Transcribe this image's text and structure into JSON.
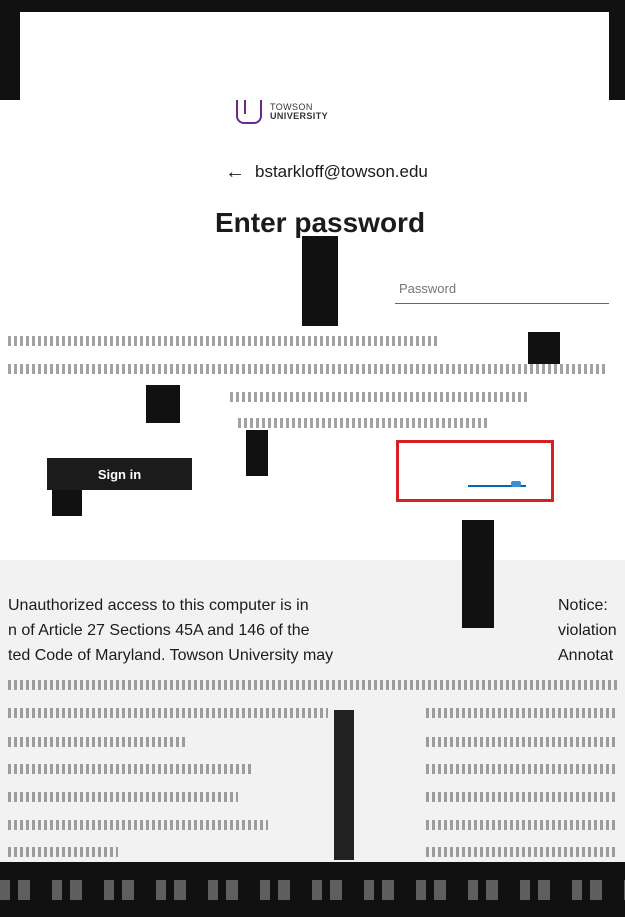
{
  "header": {
    "logo_line1": "TOWSON",
    "logo_line2": "UNIVERSITY"
  },
  "account": {
    "email": "bstarkloff@towson.edu",
    "back_icon": "arrow-left-icon"
  },
  "page": {
    "title": "Enter password"
  },
  "form": {
    "password_placeholder": "Password",
    "sign_in_label": "Sign in"
  },
  "footer": {
    "notice_left": [
      "Unauthorized access to this computer is in",
      "n of Article 27 Sections 45A and 146 of the",
      "ted Code of Maryland. Towson University may"
    ],
    "notice_right": [
      "Notice:",
      "violation",
      "Annotat"
    ]
  },
  "colors": {
    "accent": "#0067b8",
    "brand": "#6a2a8a",
    "annotation": "#d71f24",
    "footer_bg": "#f2f2f2"
  }
}
